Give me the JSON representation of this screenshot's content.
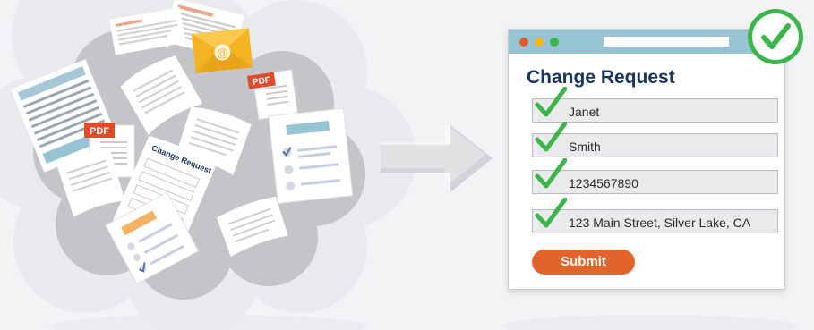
{
  "form": {
    "title": "Change Request",
    "fields": [
      {
        "value": "Janet"
      },
      {
        "value": "Smith"
      },
      {
        "value": "1234567890"
      },
      {
        "value": "123 Main Street, Silver Lake, CA"
      }
    ],
    "submit_label": "Submit"
  },
  "documents": {
    "pdf_label": "PDF",
    "email_symbol": "@",
    "paper_form_title": "Change Request"
  },
  "colors": {
    "navy": "#17355d",
    "orange": "#e0642b",
    "check_green": "#3cb54a",
    "titlebar_blue": "#97c4d3",
    "pdf_red": "#e24a2b",
    "envelope_yellow": "#f4b322",
    "cloud_grey": "#c4c5c9"
  },
  "icons": [
    "check-mark-icon",
    "pdf-file-icon",
    "email-envelope-icon",
    "arrow-right-icon",
    "check-badge-icon"
  ]
}
